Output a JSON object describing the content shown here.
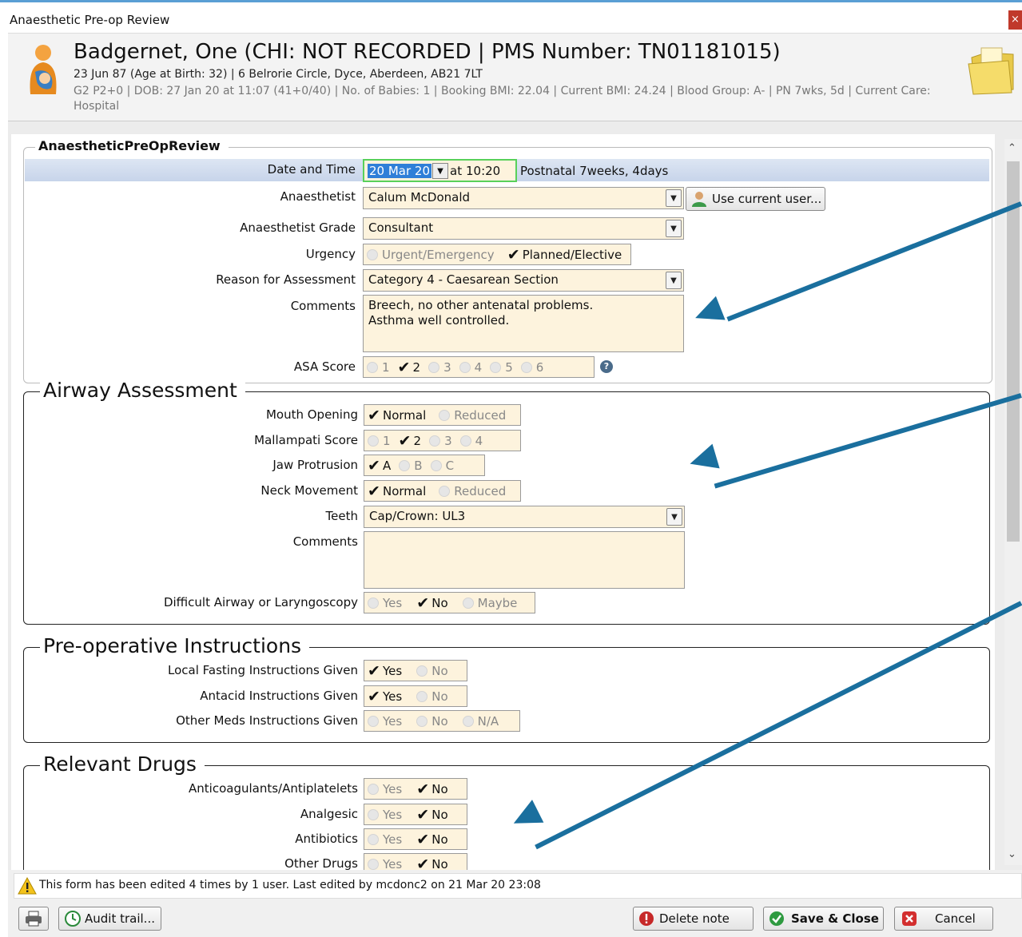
{
  "window": {
    "title": "Anaesthetic Pre-op Review",
    "close_label": "×"
  },
  "patient": {
    "name_line": "Badgernet, One (CHI: NOT RECORDED | PMS Number: TN01181015)",
    "line1": "23 Jun 87 (Age at Birth: 32) | 6 Belrorie Circle, Dyce, Aberdeen, AB21 7LT",
    "line2": "G2 P2+0  | DOB: 27 Jan 20 at 11:07 (41+0/40) | No. of Babies: 1 | Booking BMI: 22.04 | Current BMI: 24.24 | Blood Group: A- | PN 7wks, 5d | Current Care: Hospital",
    "avatar_icon": "mother-baby-icon",
    "folder_icon": "folder-icon"
  },
  "form": {
    "section_title": "AnaestheticPreOpReview",
    "date_label": "Date and Time",
    "date_value": "20 Mar 20",
    "time_prefix": "at",
    "time_value": "10:20",
    "postnatal_text": "Postnatal 7weeks, 4days",
    "anaesthetist_label": "Anaesthetist",
    "anaesthetist_value": "Calum McDonald",
    "use_current_user_label": "Use current user...",
    "grade_label": "Anaesthetist Grade",
    "grade_value": "Consultant",
    "urgency_label": "Urgency",
    "urgency_options": [
      "Urgent/Emergency",
      "Planned/Elective"
    ],
    "urgency_selected": "Planned/Elective",
    "reason_label": "Reason for Assessment",
    "reason_value": "Category 4 - Caesarean Section",
    "comments_label": "Comments",
    "comments_line1": "Breech, no other antenatal problems.",
    "comments_line2": "Asthma well controlled.",
    "asa_label": "ASA Score",
    "asa_options": [
      "1",
      "2",
      "3",
      "4",
      "5",
      "6"
    ],
    "asa_selected": "2",
    "help_icon": "?"
  },
  "airway": {
    "title": "Airway Assessment",
    "mouth_label": "Mouth Opening",
    "mouth_options": [
      "Normal",
      "Reduced"
    ],
    "mallampati_label": "Mallampati Score",
    "mallampati_options": [
      "1",
      "2",
      "3",
      "4"
    ],
    "jaw_label": "Jaw Protrusion",
    "jaw_options": [
      "A",
      "B",
      "C"
    ],
    "neck_label": "Neck Movement",
    "neck_options": [
      "Normal",
      "Reduced"
    ],
    "teeth_label": "Teeth",
    "teeth_value": "Cap/Crown: UL3",
    "comments_label": "Comments",
    "comments_value": "",
    "difficult_label": "Difficult Airway or Laryngoscopy",
    "difficult_options": [
      "Yes",
      "No",
      "Maybe"
    ]
  },
  "preop": {
    "title": "Pre-operative Instructions",
    "fasting_label": "Local Fasting Instructions Given",
    "antacid_label": "Antacid Instructions Given",
    "othermeds_label": "Other Meds Instructions Given",
    "yes": "Yes",
    "no": "No",
    "na": "N/A"
  },
  "drugs": {
    "title": "Relevant Drugs",
    "anticoag_label": "Anticoagulants/Antiplatelets",
    "analgesic_label": "Analgesic",
    "antibiotics_label": "Antibiotics",
    "other_label": "Other Drugs",
    "yes": "Yes",
    "no": "No"
  },
  "footer": {
    "edit_note": "This form has been edited 4 times by 1 user. Last edited by mcdonc2 on 21 Mar 20 23:08",
    "audit_label": "Audit trail...",
    "delete_label": "Delete note",
    "save_label": "Save & Close",
    "cancel_label": "Cancel"
  },
  "colors": {
    "accent": "#1a6f9e",
    "field_bg": "#fdf3dd",
    "title_line": "#5a9fd4"
  }
}
